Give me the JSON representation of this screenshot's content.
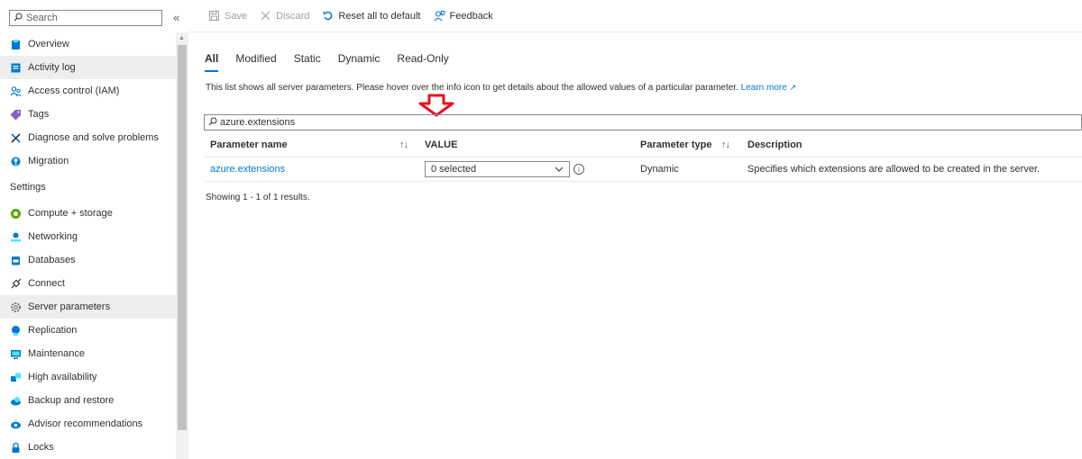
{
  "sidebar": {
    "search_placeholder": "Search",
    "collapse_glyph": "«",
    "items_top": [
      {
        "label": "Overview",
        "icon": "overview-icon",
        "color": "#0078d4"
      },
      {
        "label": "Activity log",
        "icon": "activity-log-icon",
        "color": "#0078d4"
      },
      {
        "label": "Access control (IAM)",
        "icon": "people-icon",
        "color": "#0078d4"
      },
      {
        "label": "Tags",
        "icon": "tag-icon",
        "color": "#8661c5"
      },
      {
        "label": "Diagnose and solve problems",
        "icon": "wrench-icon",
        "color": "#0078d4"
      },
      {
        "label": "Migration",
        "icon": "migration-icon",
        "color": "#0078d4"
      }
    ],
    "settings_header": "Settings",
    "items_settings": [
      {
        "label": "Compute + storage",
        "icon": "compute-icon",
        "color": "#5ea300"
      },
      {
        "label": "Networking",
        "icon": "networking-icon",
        "color": "#0078d4"
      },
      {
        "label": "Databases",
        "icon": "database-icon",
        "color": "#0078d4"
      },
      {
        "label": "Connect",
        "icon": "plug-icon",
        "color": "#323130"
      },
      {
        "label": "Server parameters",
        "icon": "gear-icon",
        "color": "#605e5c"
      },
      {
        "label": "Replication",
        "icon": "replication-icon",
        "color": "#0078d4"
      },
      {
        "label": "Maintenance",
        "icon": "maintenance-icon",
        "color": "#0078d4"
      },
      {
        "label": "High availability",
        "icon": "high-availability-icon",
        "color": "#0078d4"
      },
      {
        "label": "Backup and restore",
        "icon": "backup-icon",
        "color": "#0078d4"
      },
      {
        "label": "Advisor recommendations",
        "icon": "advisor-icon",
        "color": "#0078d4"
      },
      {
        "label": "Locks",
        "icon": "lock-icon",
        "color": "#0078d4"
      }
    ]
  },
  "toolbar": {
    "save": "Save",
    "discard": "Discard",
    "reset": "Reset all to default",
    "feedback": "Feedback"
  },
  "tabs": [
    "All",
    "Modified",
    "Static",
    "Dynamic",
    "Read-Only"
  ],
  "description": {
    "text": "This list shows all server parameters. Please hover over the info icon to get details about the allowed values of a particular parameter.",
    "learn_more": "Learn more"
  },
  "filter": {
    "value": "azure.extensions"
  },
  "table": {
    "headers": {
      "name": "Parameter name",
      "value": "VALUE",
      "type": "Parameter type",
      "description": "Description"
    },
    "rows": [
      {
        "name": "azure.extensions",
        "value": "0 selected",
        "type": "Dynamic",
        "description": "Specifies which extensions are allowed to be created in the server."
      }
    ]
  },
  "results_text": "Showing 1 - 1 of 1 results.",
  "colors": {
    "accent": "#0078d4",
    "annotation_arrow": "#e81123"
  }
}
